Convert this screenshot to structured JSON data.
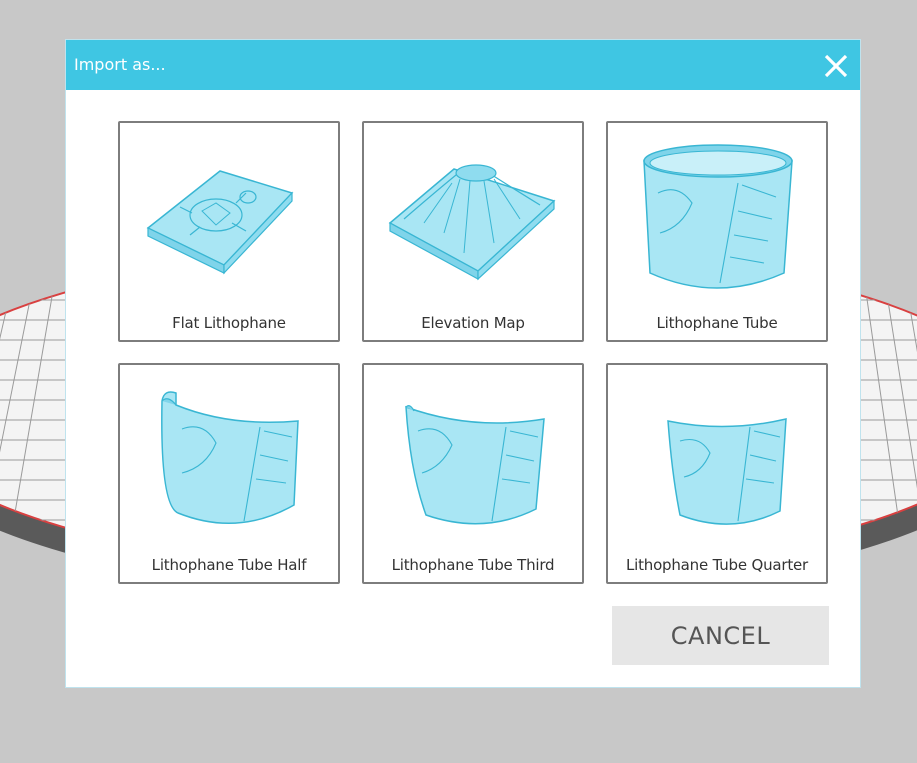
{
  "dialog": {
    "title": "Import as...",
    "close_icon": "close-icon",
    "options": [
      {
        "label": "Flat Lithophane",
        "icon": "flat-lithophane-icon"
      },
      {
        "label": "Elevation Map",
        "icon": "elevation-map-icon"
      },
      {
        "label": "Lithophane Tube",
        "icon": "lithophane-tube-icon"
      },
      {
        "label": "Lithophane Tube Half",
        "icon": "lithophane-tube-half-icon"
      },
      {
        "label": "Lithophane Tube Third",
        "icon": "lithophane-tube-third-icon"
      },
      {
        "label": "Lithophane Tube Quarter",
        "icon": "lithophane-tube-quarter-icon"
      }
    ],
    "cancel_label": "CANCEL"
  },
  "colors": {
    "titlebar": "#3fc6e3",
    "model_fill": "#a9e6f4",
    "model_stroke": "#39b6d3",
    "bed_red": "#d94040"
  }
}
